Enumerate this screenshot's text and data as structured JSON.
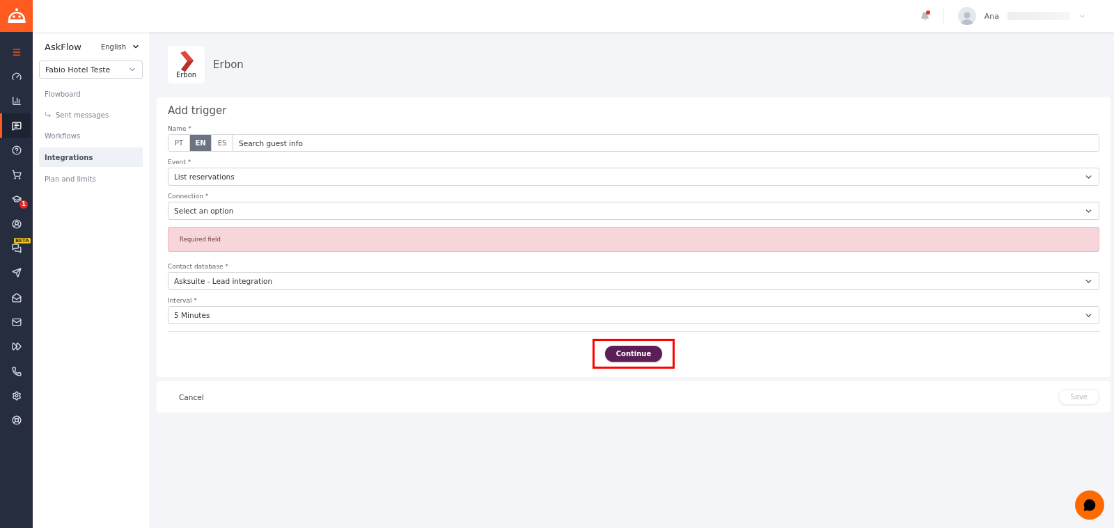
{
  "rail": {
    "items": [
      {
        "kind": "menu",
        "selected": false
      },
      {
        "kind": "gauge",
        "selected": false
      },
      {
        "kind": "chart",
        "selected": false
      },
      {
        "kind": "chat",
        "selected": true
      },
      {
        "kind": "help",
        "selected": false
      },
      {
        "kind": "cart",
        "selected": false
      },
      {
        "kind": "school",
        "selected": false,
        "badge": "1"
      },
      {
        "kind": "user",
        "selected": false
      },
      {
        "kind": "messages",
        "selected": false,
        "tag": "BETA"
      },
      {
        "kind": "send",
        "selected": false
      },
      {
        "kind": "mailopen",
        "selected": false
      },
      {
        "kind": "mail",
        "selected": false
      },
      {
        "kind": "forward",
        "selected": false
      },
      {
        "kind": "phone",
        "selected": false
      },
      {
        "kind": "settings",
        "selected": false
      },
      {
        "kind": "lifebuoy",
        "selected": false
      }
    ]
  },
  "header": {
    "notification": true,
    "user_name": "Ana"
  },
  "sidebar": {
    "title": "AskFlow",
    "language": "English",
    "account": "Fabio Hotel Teste",
    "items": [
      {
        "label": "Flowboard",
        "selected": false,
        "children": [
          {
            "label": "Sent messages",
            "selected": false
          }
        ]
      },
      {
        "label": "Workflows",
        "selected": false
      },
      {
        "label": "Integrations",
        "selected": true
      },
      {
        "label": "Plan and limits",
        "selected": false
      }
    ]
  },
  "integration": {
    "logo_text": "Erbon",
    "name": "Erbon"
  },
  "form": {
    "title": "Add trigger",
    "name_field": {
      "label": "Name *",
      "languages": [
        {
          "label": "PT",
          "selected": false
        },
        {
          "label": "EN",
          "selected": true
        },
        {
          "label": "ES",
          "selected": false
        }
      ],
      "value": "Search guest info"
    },
    "fields": [
      {
        "kind": "select",
        "label": "Event *",
        "value": "List reservations"
      },
      {
        "kind": "select",
        "label": "Connection *",
        "value": "Select an option"
      },
      {
        "kind": "alert",
        "text": "Required field"
      },
      {
        "kind": "select",
        "label": "Contact database *",
        "value": "Asksuite - Lead integration"
      },
      {
        "kind": "select",
        "label": "Interval *",
        "value": "5 Minutes"
      }
    ],
    "continue_button": {
      "label": "Continue",
      "highlighted": true
    }
  },
  "footer": {
    "cancel": "Cancel",
    "save": {
      "label": "Save",
      "disabled": true
    }
  }
}
